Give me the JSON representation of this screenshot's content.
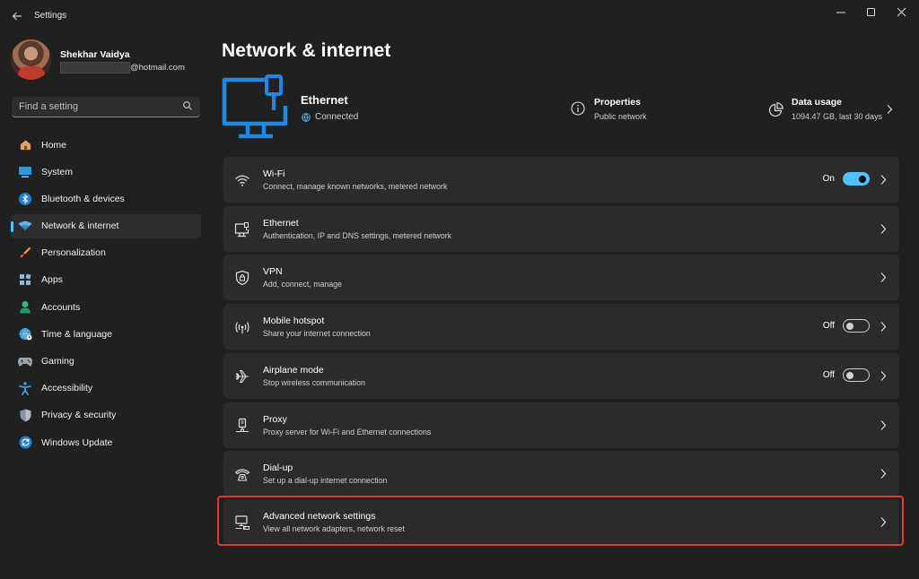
{
  "window": {
    "title": "Settings",
    "controls": {
      "minimize": "—",
      "maximize": "☐",
      "close": "✕"
    }
  },
  "profile": {
    "name": "Shekhar Vaidya",
    "email_suffix": "@hotmail.com"
  },
  "search": {
    "placeholder": "Find a setting"
  },
  "sidebar": {
    "items": [
      {
        "label": "Home",
        "icon": "home-icon",
        "active": false
      },
      {
        "label": "System",
        "icon": "system-icon",
        "active": false
      },
      {
        "label": "Bluetooth & devices",
        "icon": "bluetooth-icon",
        "active": false
      },
      {
        "label": "Network & internet",
        "icon": "network-icon",
        "active": true
      },
      {
        "label": "Personalization",
        "icon": "brush-icon",
        "active": false
      },
      {
        "label": "Apps",
        "icon": "apps-icon",
        "active": false
      },
      {
        "label": "Accounts",
        "icon": "accounts-icon",
        "active": false
      },
      {
        "label": "Time & language",
        "icon": "globe-clock-icon",
        "active": false
      },
      {
        "label": "Gaming",
        "icon": "gamepad-icon",
        "active": false
      },
      {
        "label": "Accessibility",
        "icon": "accessibility-icon",
        "active": false
      },
      {
        "label": "Privacy & security",
        "icon": "shield-icon",
        "active": false
      },
      {
        "label": "Windows Update",
        "icon": "update-icon",
        "active": false
      }
    ]
  },
  "main": {
    "title": "Network & internet",
    "connection": {
      "name": "Ethernet",
      "status": "Connected"
    },
    "properties": {
      "title": "Properties",
      "subtitle": "Public network"
    },
    "data_usage": {
      "title": "Data usage",
      "subtitle": "1094.47 GB, last 30 days"
    },
    "cards": [
      {
        "title": "Wi-Fi",
        "subtitle": "Connect, manage known networks, metered network",
        "icon": "wifi-icon",
        "toggle": "On"
      },
      {
        "title": "Ethernet",
        "subtitle": "Authentication, IP and DNS settings, metered network",
        "icon": "ethernet-icon",
        "toggle": null
      },
      {
        "title": "VPN",
        "subtitle": "Add, connect, manage",
        "icon": "vpn-shield-icon",
        "toggle": null
      },
      {
        "title": "Mobile hotspot",
        "subtitle": "Share your internet connection",
        "icon": "hotspot-icon",
        "toggle": "Off"
      },
      {
        "title": "Airplane mode",
        "subtitle": "Stop wireless communication",
        "icon": "airplane-icon",
        "toggle": "Off"
      },
      {
        "title": "Proxy",
        "subtitle": "Proxy server for Wi-Fi and Ethernet connections",
        "icon": "proxy-icon",
        "toggle": null
      },
      {
        "title": "Dial-up",
        "subtitle": "Set up a dial-up internet connection",
        "icon": "dialup-icon",
        "toggle": null
      },
      {
        "title": "Advanced network settings",
        "subtitle": "View all network adapters, network reset",
        "icon": "advanced-network-icon",
        "toggle": null
      }
    ]
  },
  "colors": {
    "accent": "#4cc2ff",
    "background": "#202020",
    "card": "#2b2b2b",
    "highlight": "#e53935"
  }
}
